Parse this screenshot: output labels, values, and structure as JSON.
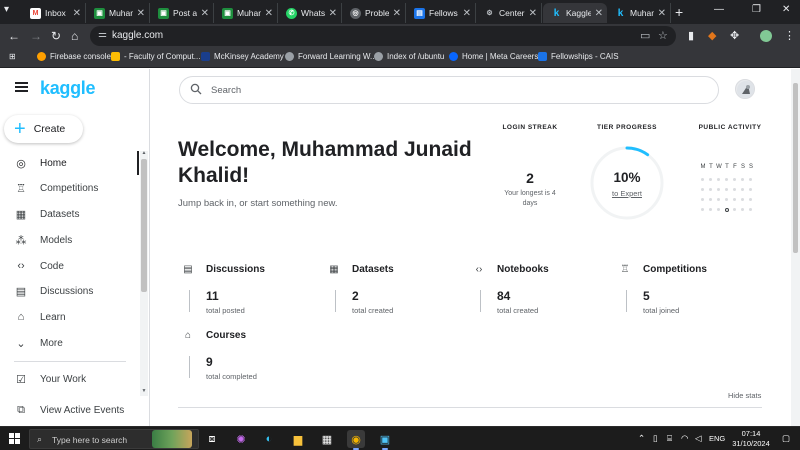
{
  "browser": {
    "tabs": [
      {
        "label": "Inbox",
        "icon": "gmail-icon",
        "color": "#ea4335"
      },
      {
        "label": "Muham",
        "icon": "classroom-icon",
        "color": "#1e8e3e"
      },
      {
        "label": "Post a",
        "icon": "classroom-icon",
        "color": "#1e8e3e"
      },
      {
        "label": "Muham",
        "icon": "classroom-icon",
        "color": "#1e8e3e"
      },
      {
        "label": "Whats",
        "icon": "whatsapp-icon",
        "color": "#25d366"
      },
      {
        "label": "Proble",
        "icon": "globe-icon",
        "color": "#9aa0a6"
      },
      {
        "label": "Fellows",
        "icon": "site-icon",
        "color": "#1a73e8"
      },
      {
        "label": "Center",
        "icon": "gear-icon",
        "color": "#9aa0a6"
      },
      {
        "label": "Kaggle",
        "icon": "kaggle-icon",
        "color": "#20beff"
      },
      {
        "label": "Muham",
        "icon": "kaggle-icon",
        "color": "#20beff"
      }
    ],
    "active_tab": 8,
    "url": "kaggle.com",
    "bookmarks": [
      {
        "label": "Firebase console",
        "color": "#ffa000"
      },
      {
        "label": "- Faculty of Comput...",
        "color": "#fbbc04"
      },
      {
        "label": "McKinsey Academy",
        "color": "#1a3e8c"
      },
      {
        "label": "Forward Learning W...",
        "color": "#9aa0a6"
      },
      {
        "label": "Index of /ubuntu",
        "color": "#9aa0a6"
      },
      {
        "label": "Home | Meta Careers",
        "color": "#0866ff"
      },
      {
        "label": "Fellowships - CAIS",
        "color": "#1a73e8"
      }
    ]
  },
  "kaggle": {
    "logo": "kaggle",
    "create_label": "Create",
    "nav": [
      {
        "label": "Home",
        "icon": "home-compass-icon",
        "active": true
      },
      {
        "label": "Competitions",
        "icon": "trophy-icon"
      },
      {
        "label": "Datasets",
        "icon": "table-icon"
      },
      {
        "label": "Models",
        "icon": "models-icon"
      },
      {
        "label": "Code",
        "icon": "code-icon"
      },
      {
        "label": "Discussions",
        "icon": "discussion-icon"
      },
      {
        "label": "Learn",
        "icon": "graduation-cap-icon"
      },
      {
        "label": "More",
        "icon": "chevron-down-icon"
      },
      {
        "label": "Your Work",
        "icon": "your-work-icon"
      },
      {
        "label": "View Active Events",
        "icon": "active-events-icon"
      }
    ],
    "search_placeholder": "Search",
    "welcome": "Welcome, Muhammad Junaid Khalid!",
    "subtitle": "Jump back in, or start something new.",
    "login_streak": {
      "title": "LOGIN STREAK",
      "value": "2",
      "sub": "Your longest is 4 days"
    },
    "tier_progress": {
      "title": "TIER PROGRESS",
      "value": "10%",
      "fraction": 0.1,
      "link": "to Expert"
    },
    "public_activity": {
      "title": "PUBLIC ACTIVITY",
      "days": [
        "M",
        "T",
        "W",
        "T",
        "F",
        "S",
        "S"
      ]
    },
    "stats": [
      {
        "title": "Discussions",
        "value": "11",
        "sub": "total posted",
        "icon": "discussion-icon"
      },
      {
        "title": "Datasets",
        "value": "2",
        "sub": "total created",
        "icon": "table-icon"
      },
      {
        "title": "Notebooks",
        "value": "84",
        "sub": "total created",
        "icon": "code-icon"
      },
      {
        "title": "Competitions",
        "value": "5",
        "sub": "total joined",
        "icon": "trophy-icon"
      },
      {
        "title": "Courses",
        "value": "9",
        "sub": "total completed",
        "icon": "graduation-cap-icon"
      }
    ],
    "hide_stats": "Hide stats",
    "accent": "#20beff"
  },
  "taskbar": {
    "search_placeholder": "Type here to search",
    "lang": "ENG",
    "time": "07:14",
    "date": "31/10/2024"
  }
}
